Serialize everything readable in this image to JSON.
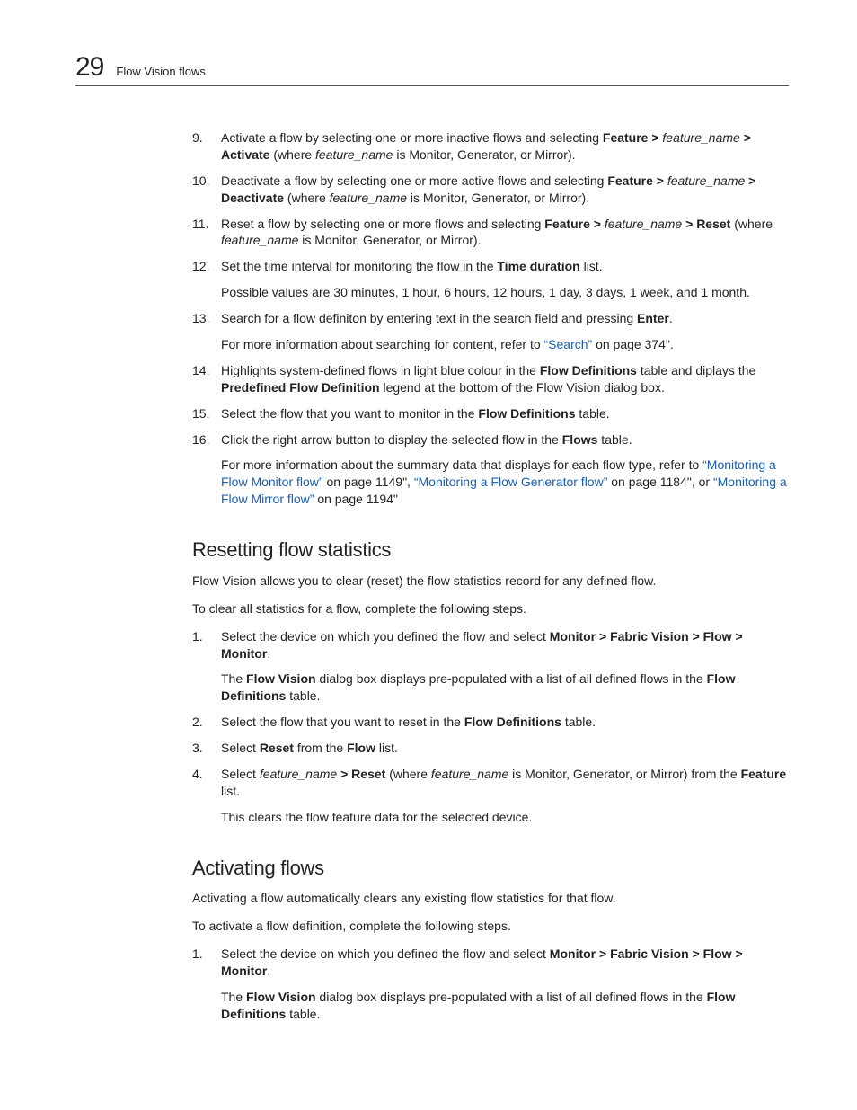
{
  "header": {
    "pageNumber": "29",
    "breadcrumb": "Flow Vision flows"
  },
  "topSteps": [
    {
      "num": "9.",
      "runs": [
        {
          "t": "Activate a flow by selecting one or more inactive flows and selecting "
        },
        {
          "t": "Feature > ",
          "b": true
        },
        {
          "t": "feature_name",
          "i": true
        },
        {
          "t": " > ",
          "b": true
        },
        {
          "t": "Activate",
          "b": true
        },
        {
          "t": " (where "
        },
        {
          "t": "feature_name",
          "i": true
        },
        {
          "t": " is Monitor, Generator, or Mirror)."
        }
      ]
    },
    {
      "num": "10.",
      "runs": [
        {
          "t": "Deactivate a flow by selecting one or more active flows and selecting "
        },
        {
          "t": "Feature > ",
          "b": true
        },
        {
          "t": "feature_name",
          "i": true
        },
        {
          "t": " > Deactivate",
          "b": true
        },
        {
          "t": " (where "
        },
        {
          "t": "feature_name",
          "i": true
        },
        {
          "t": " is Monitor, Generator, or Mirror)."
        }
      ]
    },
    {
      "num": "11.",
      "runs": [
        {
          "t": "Reset a flow by selecting one or more flows and selecting "
        },
        {
          "t": "Feature > ",
          "b": true
        },
        {
          "t": "feature_name",
          "i": true
        },
        {
          "t": " > Reset",
          "b": true
        },
        {
          "t": " (where "
        },
        {
          "t": "feature_name",
          "i": true
        },
        {
          "t": " is Monitor, Generator, or Mirror)."
        }
      ]
    },
    {
      "num": "12.",
      "runs": [
        {
          "t": "Set the time interval for monitoring the flow in the "
        },
        {
          "t": "Time duration",
          "b": true
        },
        {
          "t": " list."
        }
      ],
      "extra": [
        {
          "runs": [
            {
              "t": "Possible values are 30 minutes, 1 hour, 6 hours, 12 hours, 1 day, 3 days, 1 week, and 1 month."
            }
          ]
        }
      ]
    },
    {
      "num": "13.",
      "runs": [
        {
          "t": "Search for a flow definiton by entering text in the search field and pressing "
        },
        {
          "t": "Enter",
          "b": true
        },
        {
          "t": "."
        }
      ],
      "extra": [
        {
          "runs": [
            {
              "t": "For more information about searching for content, refer to "
            },
            {
              "t": "“Search”",
              "link": true
            },
            {
              "t": " on page 374\"."
            }
          ]
        }
      ]
    },
    {
      "num": "14.",
      "runs": [
        {
          "t": "Highlights system-defined flows in light blue colour in the "
        },
        {
          "t": "Flow Definitions",
          "b": true
        },
        {
          "t": " table and diplays the "
        },
        {
          "t": "Predefined Flow Definition",
          "b": true
        },
        {
          "t": " legend at the bottom of the Flow Vision dialog box."
        }
      ]
    },
    {
      "num": "15.",
      "runs": [
        {
          "t": "Select the flow that you want to monitor in the "
        },
        {
          "t": "Flow Definitions",
          "b": true
        },
        {
          "t": " table."
        }
      ]
    },
    {
      "num": "16.",
      "runs": [
        {
          "t": "Click the right arrow button to display the selected flow in the "
        },
        {
          "t": "Flows",
          "b": true
        },
        {
          "t": " table."
        }
      ],
      "extra": [
        {
          "runs": [
            {
              "t": "For more information about the summary data that displays for each flow type, refer to "
            },
            {
              "t": "“Monitoring a Flow Monitor flow”",
              "link": true
            },
            {
              "t": " on page 1149\", "
            },
            {
              "t": "“Monitoring a Flow Generator flow”",
              "link": true
            },
            {
              "t": " on page 1184\", or "
            },
            {
              "t": "“Monitoring a Flow Mirror flow”",
              "link": true
            },
            {
              "t": " on page 1194\""
            }
          ]
        }
      ]
    }
  ],
  "section1": {
    "heading": "Resetting flow statistics",
    "intro1": "Flow Vision allows you to clear (reset) the flow statistics record for any defined flow.",
    "intro2": "To clear all statistics for a flow, complete the following steps.",
    "steps": [
      {
        "num": "1.",
        "runs": [
          {
            "t": "Select the device on which you defined the flow and select "
          },
          {
            "t": "Monitor > Fabric Vision > Flow > Monitor",
            "b": true
          },
          {
            "t": "."
          }
        ],
        "extra": [
          {
            "runs": [
              {
                "t": "The "
              },
              {
                "t": "Flow Vision",
                "b": true
              },
              {
                "t": " dialog box displays pre-populated with a list of all defined flows in the "
              },
              {
                "t": "Flow Definitions",
                "b": true
              },
              {
                "t": " table."
              }
            ]
          }
        ]
      },
      {
        "num": "2.",
        "runs": [
          {
            "t": "Select the flow that you want to reset in the "
          },
          {
            "t": "Flow Definitions",
            "b": true
          },
          {
            "t": " table."
          }
        ]
      },
      {
        "num": "3.",
        "runs": [
          {
            "t": "Select "
          },
          {
            "t": "Reset",
            "b": true
          },
          {
            "t": " from the "
          },
          {
            "t": "Flow",
            "b": true
          },
          {
            "t": " list."
          }
        ]
      },
      {
        "num": "4.",
        "runs": [
          {
            "t": "Select "
          },
          {
            "t": "feature_name",
            "i": true
          },
          {
            "t": " > Reset",
            "b": true
          },
          {
            "t": " (where "
          },
          {
            "t": "feature_name",
            "i": true
          },
          {
            "t": " is Monitor, Generator, or Mirror) from the "
          },
          {
            "t": "Feature",
            "b": true
          },
          {
            "t": " list."
          }
        ],
        "extra": [
          {
            "runs": [
              {
                "t": "This clears the flow feature data for the selected device."
              }
            ]
          }
        ]
      }
    ]
  },
  "section2": {
    "heading": "Activating flows",
    "intro1": "Activating a flow automatically clears any existing flow statistics for that flow.",
    "intro2": "To activate a flow definition, complete the following steps.",
    "steps": [
      {
        "num": "1.",
        "runs": [
          {
            "t": "Select the device on which you defined the flow and select "
          },
          {
            "t": "Monitor > Fabric Vision > Flow > Monitor",
            "b": true
          },
          {
            "t": "."
          }
        ],
        "extra": [
          {
            "runs": [
              {
                "t": "The "
              },
              {
                "t": "Flow Vision",
                "b": true
              },
              {
                "t": " dialog box displays pre-populated with a list of all defined flows in the "
              },
              {
                "t": "Flow Definitions",
                "b": true
              },
              {
                "t": " table."
              }
            ]
          }
        ]
      }
    ]
  }
}
